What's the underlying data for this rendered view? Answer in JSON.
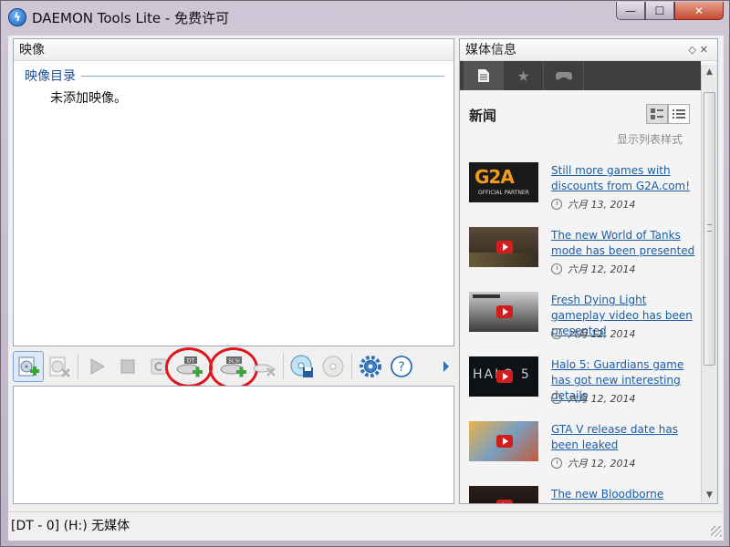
{
  "window": {
    "title": "DAEMON Tools Lite - 免费许可",
    "min_glyph": "—",
    "max_glyph": "☐",
    "close_glyph": "✕"
  },
  "image_panel": {
    "header": "映像",
    "catalog_label": "映像目录",
    "empty_message": "未添加映像。"
  },
  "toolbar": {
    "dt_badge": "DT",
    "scsi_badge": "SCSI",
    "help_glyph": "?"
  },
  "media_panel": {
    "header": "媒体信息",
    "header_buttons": "◇✕",
    "news_title": "新闻",
    "list_style_label": "显示列表样式",
    "news": [
      {
        "title": "Still more games with discounts from G2A.com!",
        "date": "六月 13, 2014",
        "thumb": "g2a"
      },
      {
        "title": "The new World of Tanks mode has been presented",
        "date": "六月 12, 2014",
        "thumb": "video"
      },
      {
        "title": "Fresh Dying Light gameplay video has been presented",
        "date": "六月 12, 2014",
        "thumb": "video"
      },
      {
        "title": "Halo 5: Guardians game has got new interesting details",
        "date": "六月 12, 2014",
        "thumb": "halo"
      },
      {
        "title": "GTA V release date has been leaked",
        "date": "六月 12, 2014",
        "thumb": "gta"
      },
      {
        "title": "The new Bloodborne game",
        "date": "",
        "thumb": "video"
      }
    ],
    "g2a_logo": "G2A",
    "g2a_sub": "OFFICIAL PARTNER",
    "halo_logo": "HALO 5"
  },
  "status": {
    "text": "[DT - 0] (H:) 无媒体"
  },
  "colors": {
    "link": "#1a5ea8",
    "accent_ring": "#e2141c",
    "tabbar": "#3e3e3e"
  }
}
